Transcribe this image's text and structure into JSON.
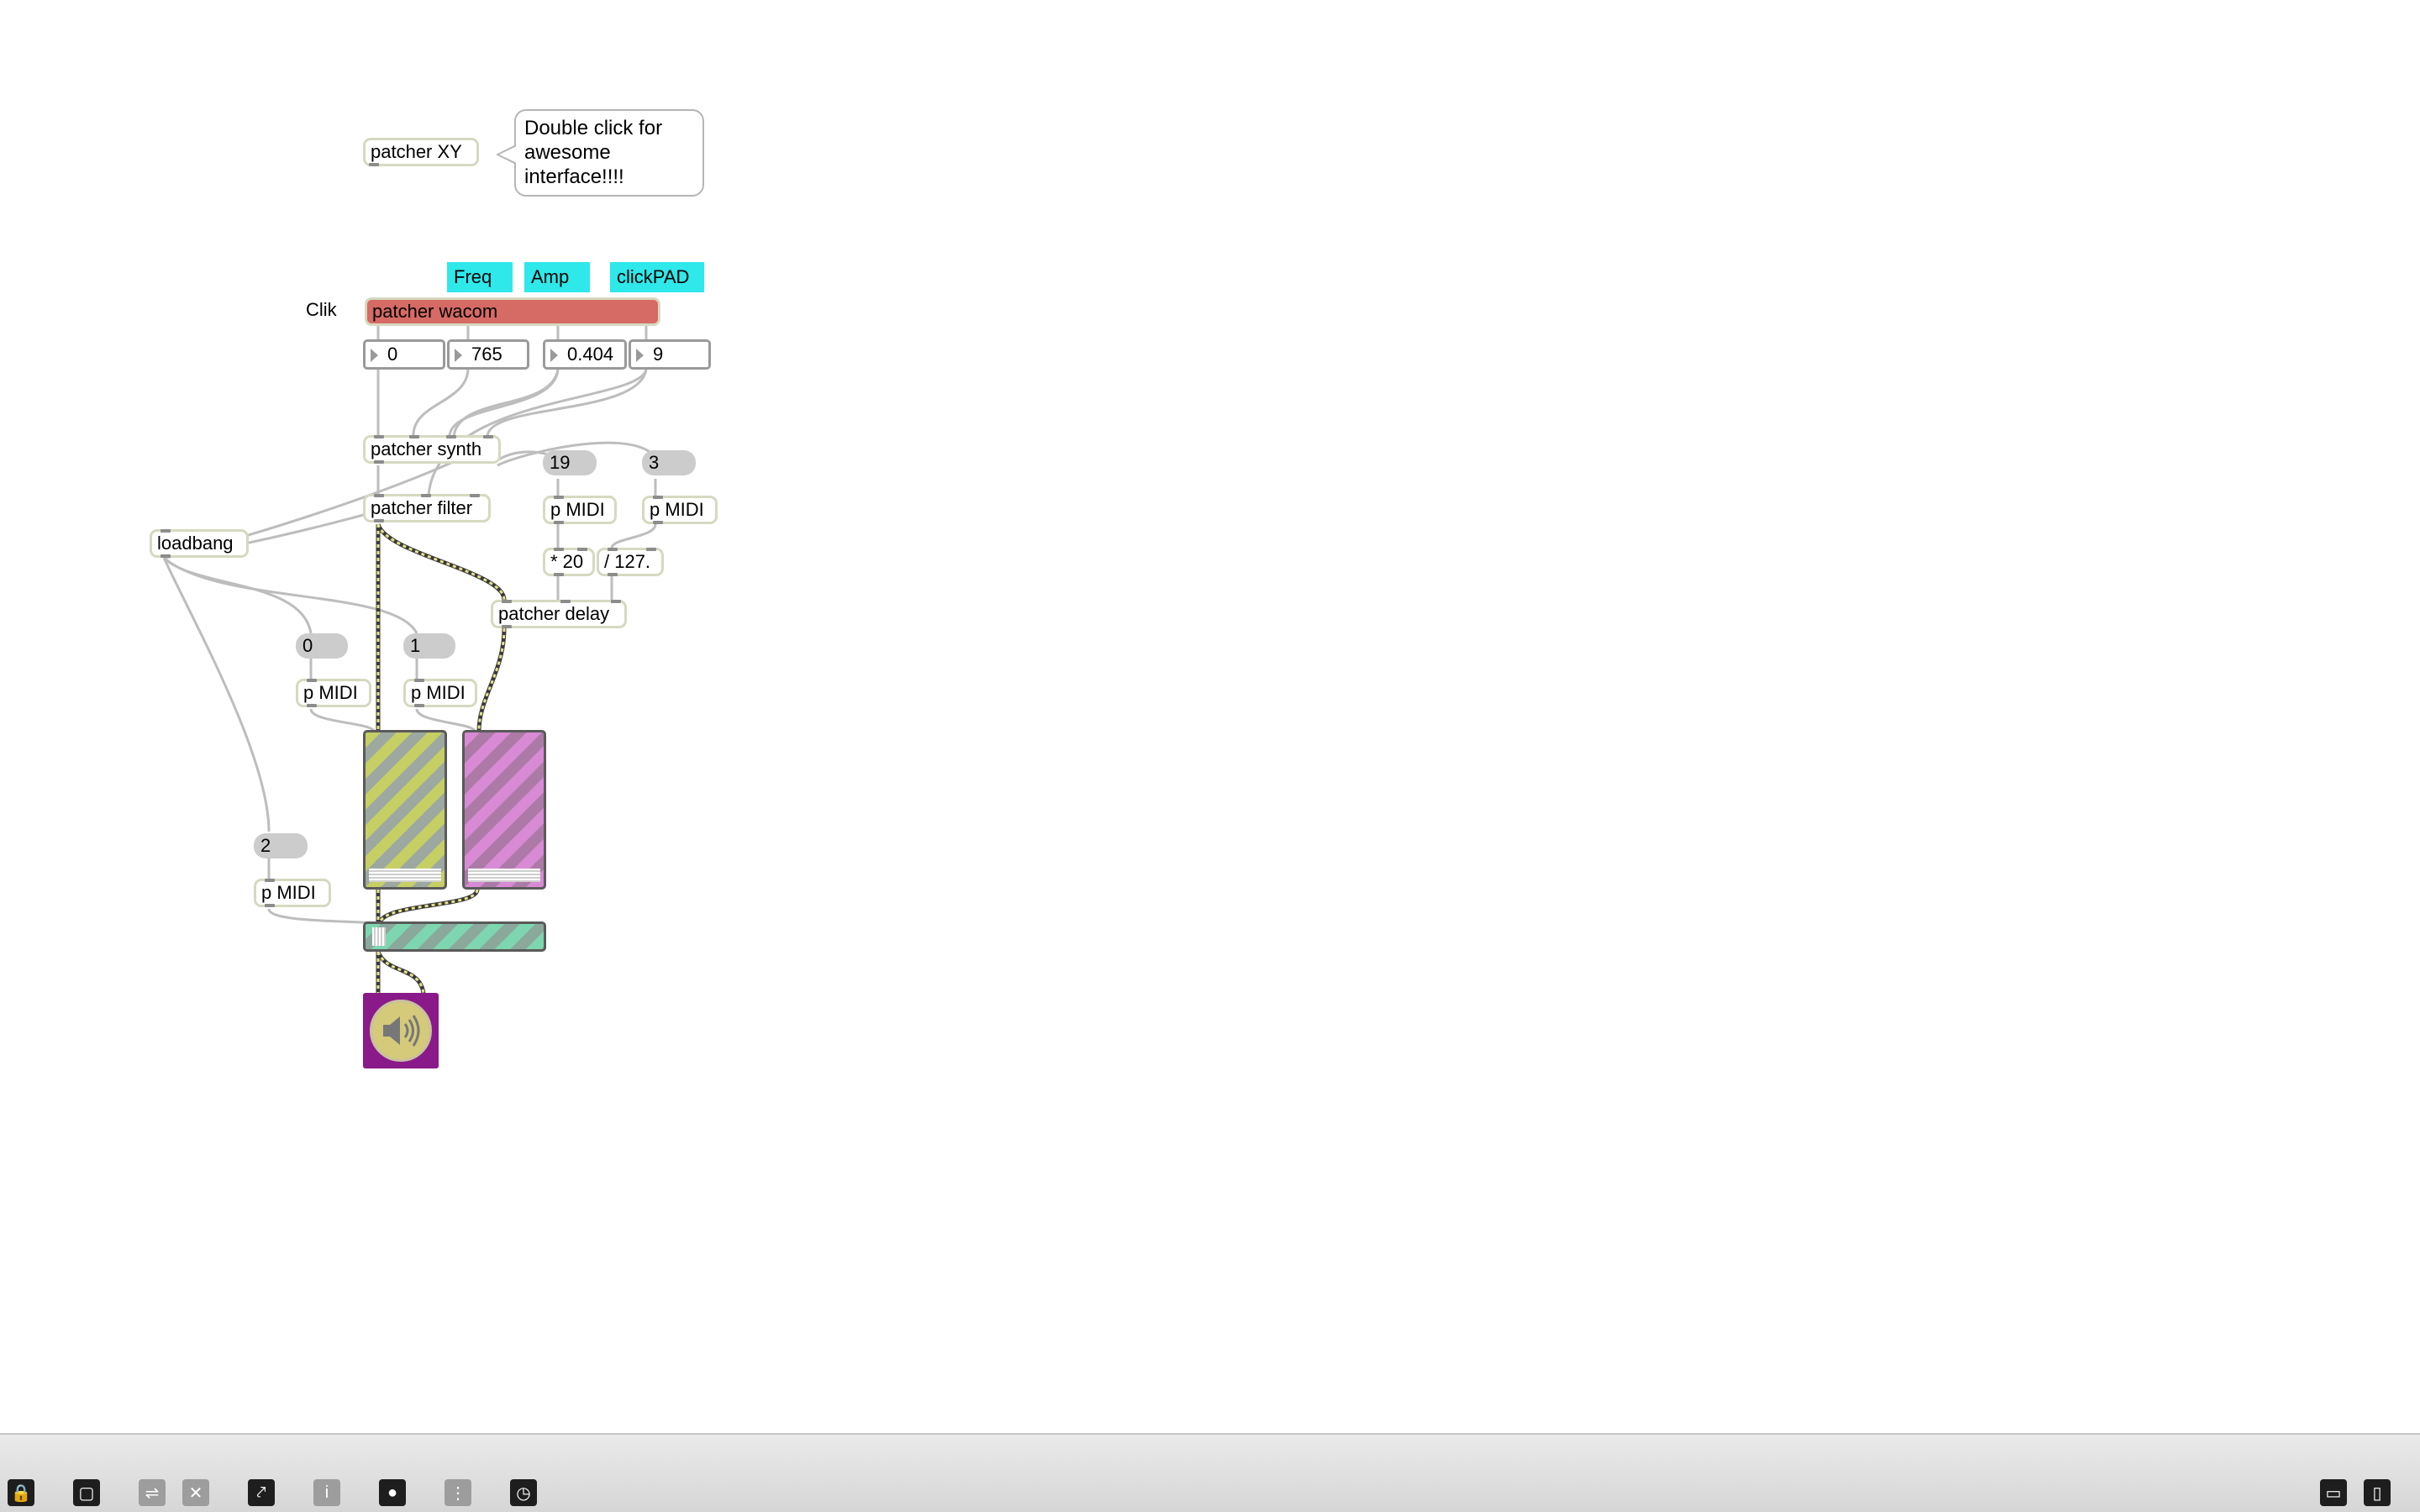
{
  "window": {
    "title": ""
  },
  "comments": {
    "bubble": "Double click for awesome interface!!!!",
    "clik": "Clik"
  },
  "labels": {
    "freq": "Freq",
    "amp": "Amp",
    "clickpad": "clickPAD"
  },
  "objects": {
    "patcher_xy": "patcher XY",
    "patcher_wacom": "patcher wacom",
    "patcher_synth": "patcher synth",
    "patcher_filter": "patcher filter",
    "patcher_delay": "patcher delay",
    "loadbang": "loadbang",
    "p_midi": "p MIDI",
    "mul20": "* 20",
    "div127": "/ 127."
  },
  "number_boxes": {
    "n1": "0",
    "n2": "765",
    "n3": "0.404",
    "n4": "9"
  },
  "messages": {
    "m19": "19",
    "m3": "3",
    "m0": "0",
    "m1": "1",
    "m2": "2"
  },
  "colors": {
    "accent_wacom": "#d66a64",
    "label_bg": "#2ee8ea",
    "gain_left": "#c6cf64",
    "gain_right": "#d98ad4",
    "gain_master": "#7ed6b0",
    "dac_bg": "#8a1a8a"
  },
  "toolbar": {
    "items": [
      "lock-icon",
      "presentation-icon",
      "patch-cords-icon",
      "delete-icon",
      "debug-icon",
      "inspector-icon",
      "slider-icon",
      "grid-icon",
      "clock-icon",
      "sidebar-left-icon",
      "sidebar-right-icon"
    ]
  }
}
